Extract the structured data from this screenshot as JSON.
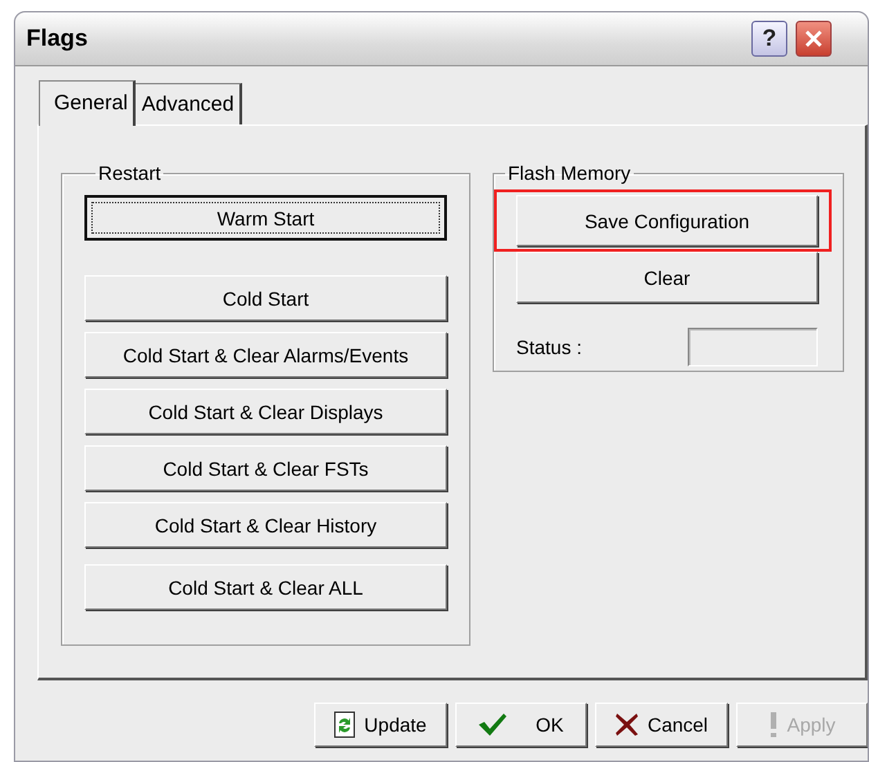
{
  "window": {
    "title": "Flags",
    "help_button": "?"
  },
  "tabs": [
    {
      "label": "General",
      "selected": true
    },
    {
      "label": "Advanced",
      "selected": false
    }
  ],
  "restart": {
    "title": "Restart",
    "buttons": [
      {
        "label": "Warm Start",
        "default": true
      },
      {
        "label": "Cold Start",
        "default": false
      },
      {
        "label": "Cold Start & Clear Alarms/Events",
        "default": false
      },
      {
        "label": "Cold Start & Clear Displays",
        "default": false
      },
      {
        "label": "Cold Start & Clear FSTs",
        "default": false
      },
      {
        "label": "Cold Start & Clear History",
        "default": false
      },
      {
        "label": "Cold Start & Clear ALL",
        "default": false
      }
    ]
  },
  "flash_memory": {
    "title": "Flash Memory",
    "buttons": [
      {
        "label": "Save Configuration",
        "highlighted": true
      },
      {
        "label": "Clear",
        "highlighted": false
      }
    ],
    "status_label": "Status :"
  },
  "footer_buttons": [
    {
      "kind": "update",
      "label": "Update",
      "disabled": false
    },
    {
      "kind": "ok",
      "label": "OK",
      "disabled": false
    },
    {
      "kind": "cancel",
      "label": "Cancel",
      "disabled": false
    },
    {
      "kind": "apply",
      "label": "Apply",
      "disabled": true
    }
  ]
}
